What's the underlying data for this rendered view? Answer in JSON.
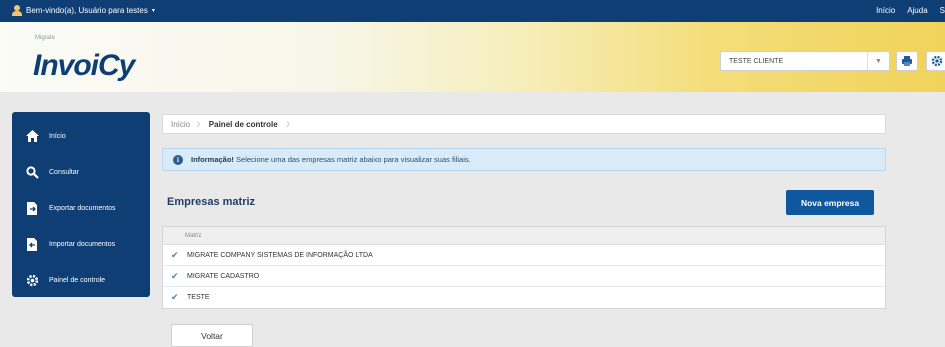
{
  "topbar": {
    "welcome": "Bem-vindo(a), Usuário para testes",
    "caret": "▾",
    "links": [
      "Início",
      "Ajuda",
      "S"
    ]
  },
  "banner": {
    "brand_small": "Migrate",
    "logo": "InvoiCy",
    "client_select_value": "TESTE CLIENTE"
  },
  "sidebar": {
    "items": [
      {
        "label": "Início",
        "icon": "home-icon"
      },
      {
        "label": "Consultar",
        "icon": "search-icon"
      },
      {
        "label": "Exportar documentos",
        "icon": "export-icon"
      },
      {
        "label": "Importar documentos",
        "icon": "import-icon"
      },
      {
        "label": "Painel de controle",
        "icon": "gear-icon"
      }
    ]
  },
  "breadcrumb": [
    "Início",
    "Painel de controle"
  ],
  "info": {
    "strong": "Informação!",
    "text": " Selecione uma das empresas matriz abaixo para visualizar suas filiais."
  },
  "section": {
    "title": "Empresas matriz",
    "new_button": "Nova empresa"
  },
  "table": {
    "header": "Matriz",
    "rows": [
      "MIGRATE COMPANY SISTEMAS DE INFORMAÇÃO LTDA",
      "MIGRATE CADASTRO",
      "TESTE"
    ]
  },
  "footer": {
    "back_button": "Voltar"
  },
  "colors": {
    "navy": "#0e3e74",
    "primary_button": "#10589e",
    "info_bg": "#d9ebf8"
  }
}
